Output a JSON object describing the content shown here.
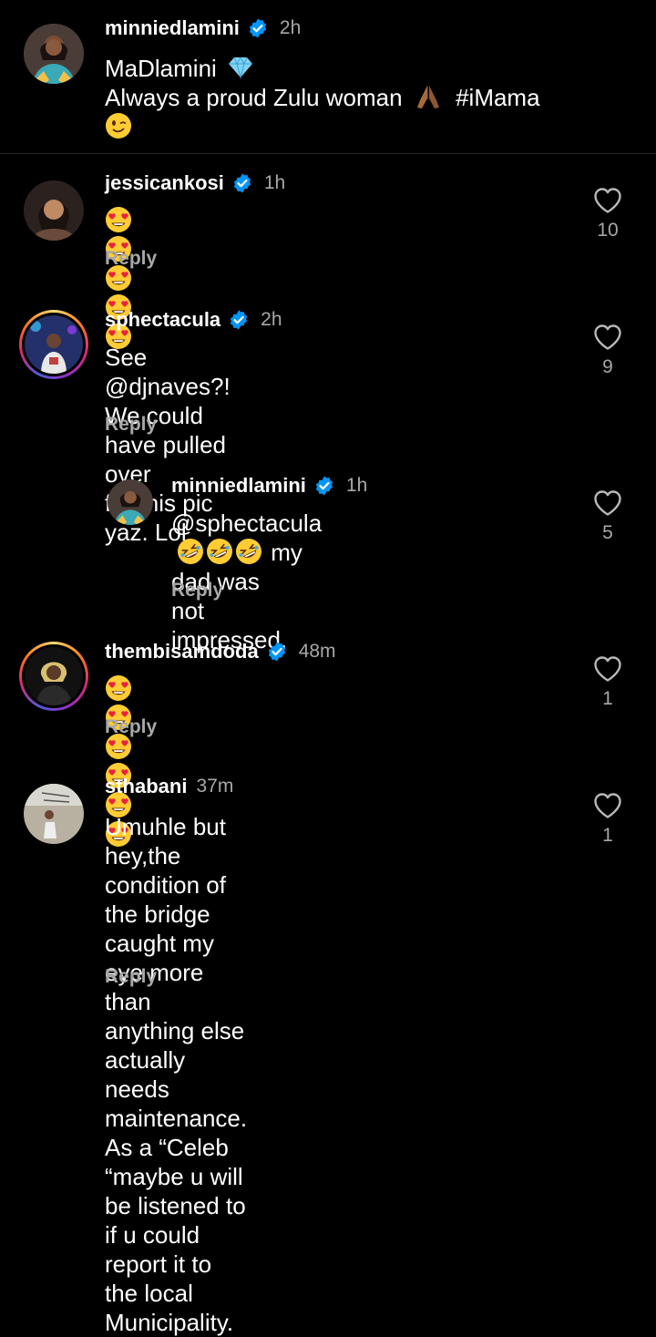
{
  "caption": {
    "username": "minniedlamini",
    "time": "2h",
    "line1": "MaDlamini",
    "line2_prefix": "Always a proud Zulu woman",
    "hashtag": "#iMama",
    "verified": true
  },
  "comments": [
    {
      "username": "jessicankosi",
      "time": "1h",
      "text": "",
      "emoji": [
        "heart-eyes",
        "heart-eyes",
        "heart-eyes",
        "heart-eyes",
        "heart-eyes"
      ],
      "reply_label": "Reply",
      "likes": "10",
      "verified": true
    },
    {
      "username": "sphectacula",
      "time": "2h",
      "line1": "See @djnaves?! We could have pulled over",
      "line2": "for this pic yaz. Lol",
      "reply_label": "Reply",
      "likes": "9",
      "verified": true
    },
    {
      "username": "minniedlamini",
      "time": "1h",
      "mention": "@sphectacula",
      "after_emoji": "my dad was",
      "line2": "not impressed.",
      "reply_label": "Reply",
      "likes": "5",
      "verified": true
    },
    {
      "username": "thembisamdoda",
      "time": "48m",
      "emoji": [
        "heart-eyes",
        "heart-eyes",
        "heart-eyes",
        "heart-eyes",
        "heart-eyes",
        "heart-eyes"
      ],
      "reply_label": "Reply",
      "likes": "1",
      "verified": true
    },
    {
      "username": "sthabani",
      "time": "37m",
      "lines": [
        "Umuhle but hey,the condition of the bridge",
        "caught my eye more than anything else",
        "actually needs maintenance. As a “Celeb",
        "“maybe u will be listened to if u could",
        "report it  to the local Municipality."
      ],
      "reply_label": "Reply",
      "likes": "1",
      "verified": false
    }
  ],
  "colors": {
    "background": "#000000",
    "secondary_text": "#a8a8a8",
    "verified_blue": "#0095f6",
    "divider": "#262626"
  }
}
